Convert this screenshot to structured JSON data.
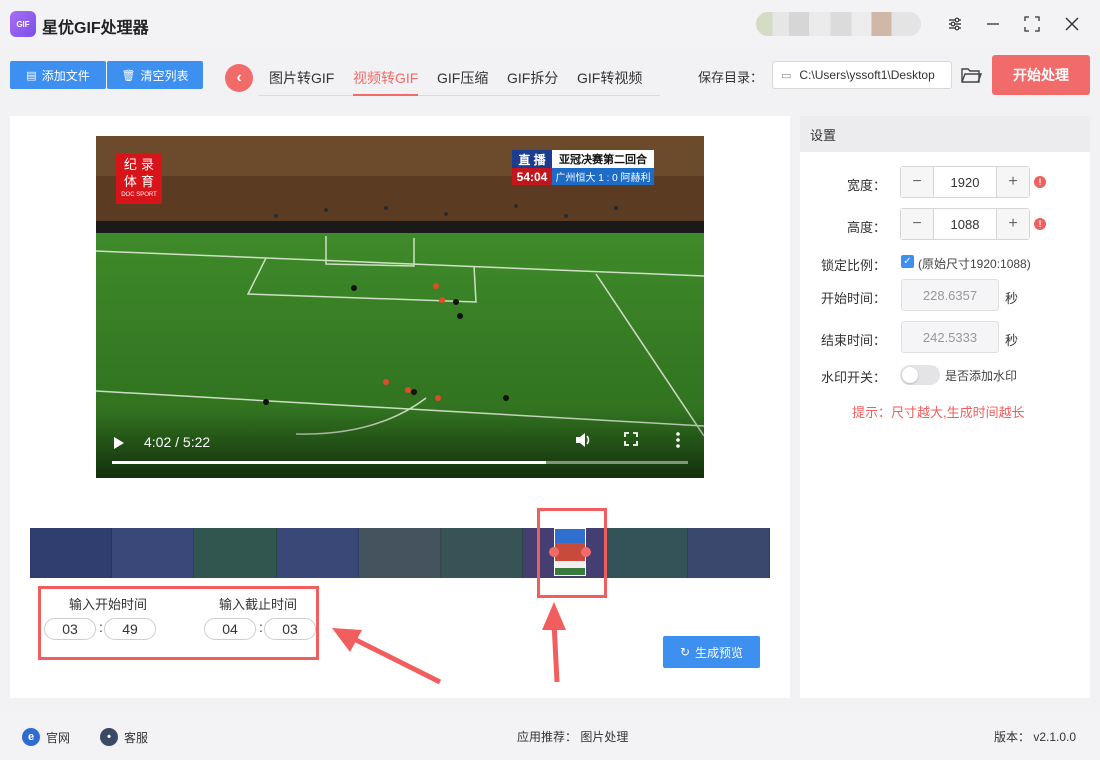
{
  "app": {
    "title": "星优GIF处理器",
    "logo_text": "GIF"
  },
  "toolbar": {
    "add_file": "添加文件",
    "clear_list": "清空列表",
    "tabs": [
      "图片转GIF",
      "视频转GIF",
      "GIF压缩",
      "GIF拆分",
      "GIF转视频"
    ],
    "active_tab": "视频转GIF",
    "save_dir_label": "保存目录：",
    "save_dir_value": "C:\\Users\\yssoft1\\Desktop",
    "start_button": "开始处理"
  },
  "video": {
    "logo_line1": "纪 录",
    "logo_line2": "体 育",
    "logo_small": "DOC SPORT",
    "live_label": "直 播",
    "event": "亚冠决赛第二回合",
    "match_clock": "54:04",
    "score": "广州恒大 1 : 0 阿赫利",
    "time_display": "4:02 / 5:22",
    "progress": 0.753
  },
  "clip": {
    "start_label": "输入开始时间",
    "end_label": "输入截止时间",
    "start_min": "03",
    "start_sec": "49",
    "end_min": "04",
    "end_sec": "03",
    "preview_button": "生成预览"
  },
  "settings": {
    "header": "设置",
    "width_label": "宽度：",
    "width_value": "1920",
    "height_label": "高度：",
    "height_value": "1088",
    "lock_label": "锁定比例：",
    "lock_text": "(原始尺寸1920:1088)",
    "start_label": "开始时间：",
    "start_value": "228.6357",
    "end_label": "结束时间：",
    "end_value": "242.5333",
    "unit": "秒",
    "watermark_label": "水印开关：",
    "watermark_text": "是否添加水印",
    "tip": "提示：尺寸越大,生成时间越长"
  },
  "footer": {
    "website": "官网",
    "service": "客服",
    "recommend": "应用推荐：  图片处理",
    "version": "版本：  v2.1.0.0"
  },
  "colors": {
    "accent": "#f26b6b",
    "primary": "#3d8ff0"
  }
}
